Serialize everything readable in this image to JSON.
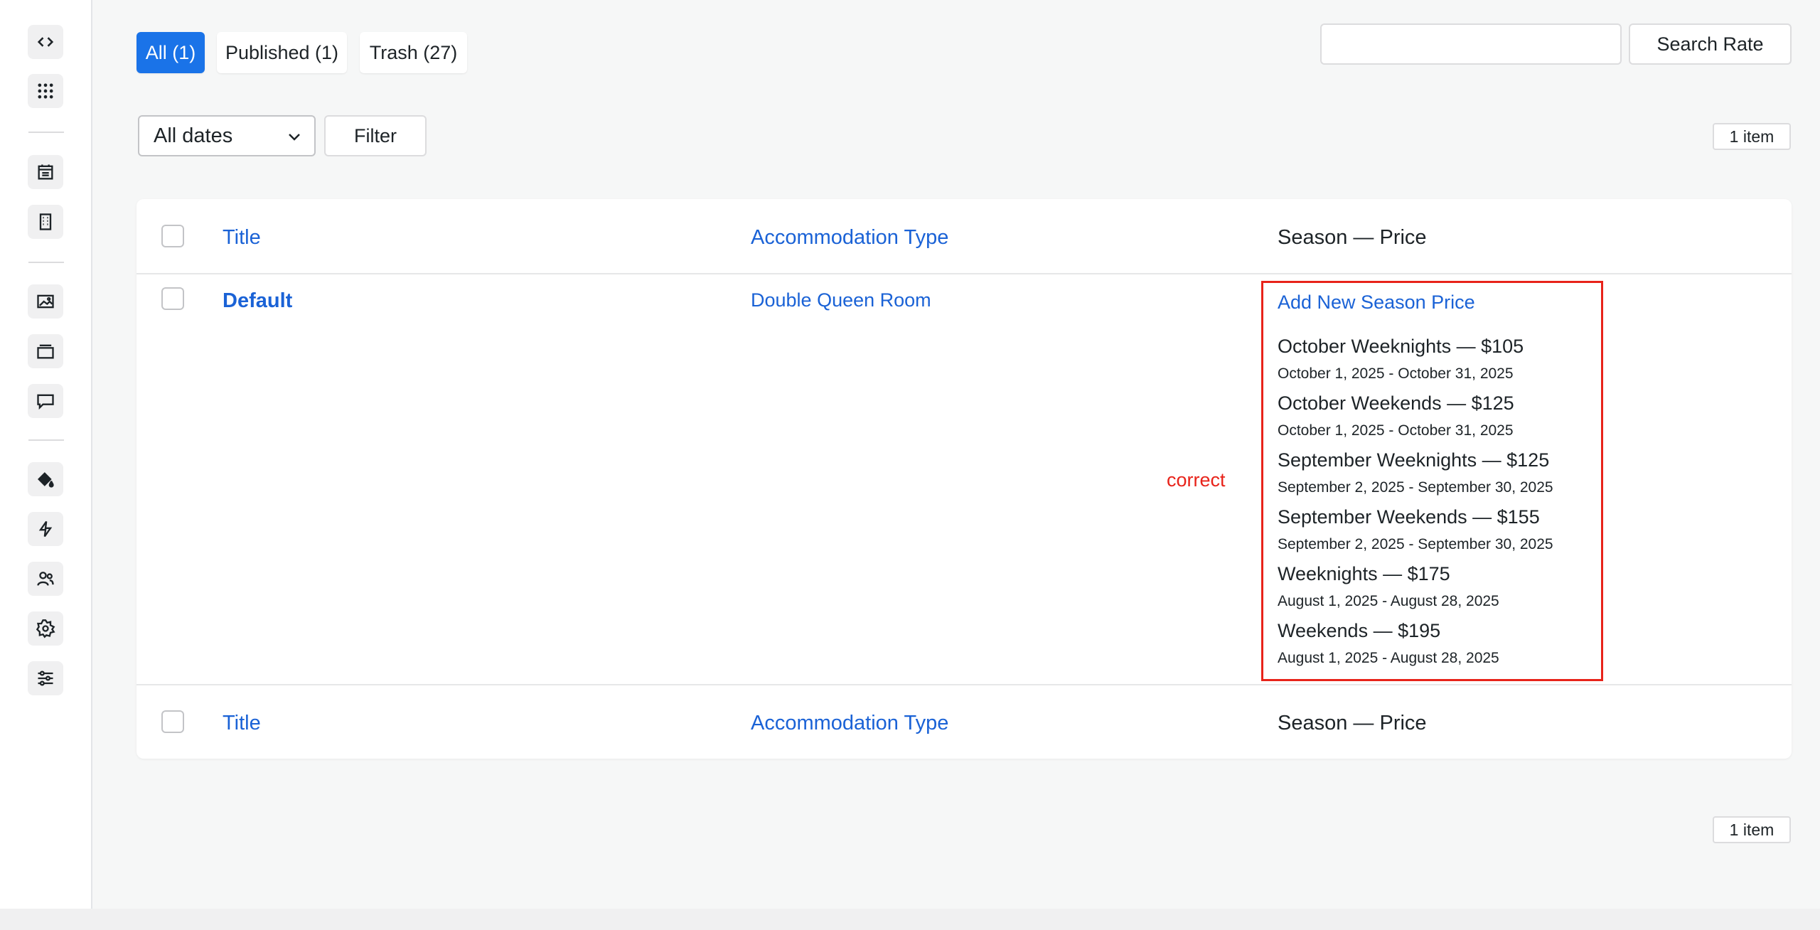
{
  "sidebar": {
    "icons": [
      "code-icon",
      "apps-grid-icon",
      "calendar-icon",
      "building-icon",
      "image-icon",
      "layers-icon",
      "comment-icon",
      "paint-bucket-icon",
      "lightning-icon",
      "users-icon",
      "settings-icon",
      "sliders-icon"
    ]
  },
  "status_tabs": {
    "all": "All (1)",
    "published": "Published (1)",
    "trash": "Trash (27)"
  },
  "search": {
    "value": "",
    "button_label": "Search Rate"
  },
  "filters": {
    "date_selected": "All dates",
    "filter_label": "Filter"
  },
  "item_count_top": "1 item",
  "item_count_bottom": "1 item",
  "table": {
    "headers": {
      "title": "Title",
      "accommodation_type": "Accommodation Type",
      "season_price": "Season — Price"
    },
    "row": {
      "title": "Default",
      "accommodation_type": "Double Queen Room",
      "add_season_label": "Add New Season Price",
      "seasons": [
        {
          "name": "October Weeknights — $105",
          "dates": "October 1, 2025 - October 31, 2025"
        },
        {
          "name": "October Weekends — $125",
          "dates": "October 1, 2025 - October 31, 2025"
        },
        {
          "name": "September Weeknights — $125",
          "dates": "September 2, 2025 - September 30, 2025"
        },
        {
          "name": "September Weekends — $155",
          "dates": "September 2, 2025 - September 30, 2025"
        },
        {
          "name": "Weeknights — $175",
          "dates": "August 1, 2025 - August 28, 2025"
        },
        {
          "name": "Weekends — $195",
          "dates": "August 1, 2025 - August 28, 2025"
        }
      ]
    }
  },
  "annotation": {
    "note": "correct",
    "color": "#e8231a"
  },
  "colors": {
    "accent": "#1a73e8",
    "link": "#1a62d6"
  }
}
